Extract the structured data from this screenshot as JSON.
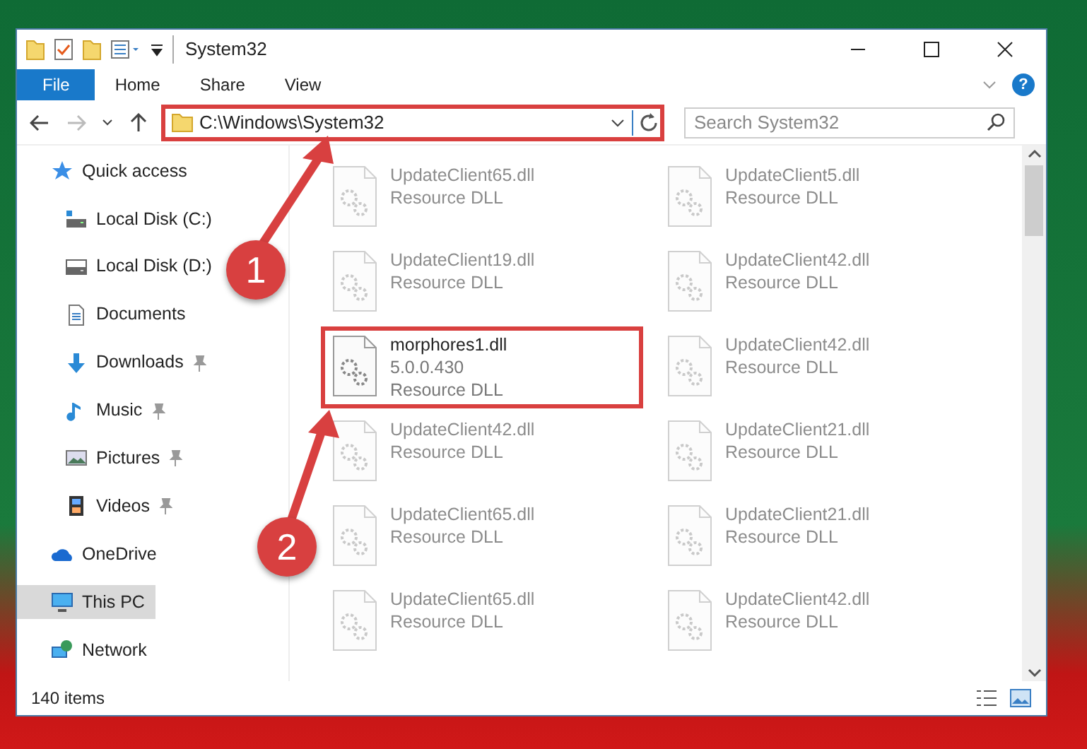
{
  "window": {
    "title": "System32",
    "help": "?"
  },
  "ribbon_tabs": [
    {
      "label": "File",
      "selected": true
    },
    {
      "label": "Home",
      "selected": false
    },
    {
      "label": "Share",
      "selected": false
    },
    {
      "label": "View",
      "selected": false
    }
  ],
  "address": {
    "path": "C:\\Windows\\System32",
    "highlighted": true
  },
  "search": {
    "placeholder": "Search System32"
  },
  "sidebar": {
    "items": [
      {
        "label": "Quick access",
        "selected": false,
        "children": [
          {
            "label": "Local Disk (C:)",
            "pinned": false
          },
          {
            "label": "Local Disk (D:)",
            "pinned": false
          },
          {
            "label": "Documents",
            "pinned": false
          },
          {
            "label": "Downloads",
            "pinned": true
          },
          {
            "label": "Music",
            "pinned": true
          },
          {
            "label": "Pictures",
            "pinned": true
          },
          {
            "label": "Videos",
            "pinned": true
          }
        ]
      },
      {
        "label": "OneDrive",
        "selected": false
      },
      {
        "label": "This PC",
        "selected": true
      },
      {
        "label": "Network",
        "selected": false
      }
    ]
  },
  "files": [
    {
      "name": "UpdateClient65.dll",
      "type": "Resource DLL",
      "faded": true,
      "highlighted": false
    },
    {
      "name": "UpdateClient5.dll",
      "type": "Resource DLL",
      "faded": true,
      "highlighted": false
    },
    {
      "name": "UpdateClient19.dll",
      "type": "Resource DLL",
      "faded": true,
      "highlighted": false
    },
    {
      "name": "UpdateClient42.dll",
      "type": "Resource DLL",
      "faded": true,
      "highlighted": false
    },
    {
      "name": "morphores1.dll",
      "version": "5.0.0.430",
      "type": "Resource DLL",
      "faded": false,
      "highlighted": true
    },
    {
      "name": "UpdateClient42.dll",
      "type": "Resource DLL",
      "faded": true,
      "highlighted": false
    },
    {
      "name": "UpdateClient42.dll",
      "type": "Resource DLL",
      "faded": true,
      "highlighted": false
    },
    {
      "name": "UpdateClient21.dll",
      "type": "Resource DLL",
      "faded": true,
      "highlighted": false
    },
    {
      "name": "UpdateClient65.dll",
      "type": "Resource DLL",
      "faded": true,
      "highlighted": false
    },
    {
      "name": "UpdateClient21.dll",
      "type": "Resource DLL",
      "faded": true,
      "highlighted": false
    },
    {
      "name": "UpdateClient65.dll",
      "type": "Resource DLL",
      "faded": true,
      "highlighted": false
    },
    {
      "name": "UpdateClient42.dll",
      "type": "Resource DLL",
      "faded": true,
      "highlighted": false
    }
  ],
  "status_bar": {
    "count": "140 items"
  },
  "callouts": [
    {
      "label": "1"
    },
    {
      "label": "2"
    }
  ]
}
